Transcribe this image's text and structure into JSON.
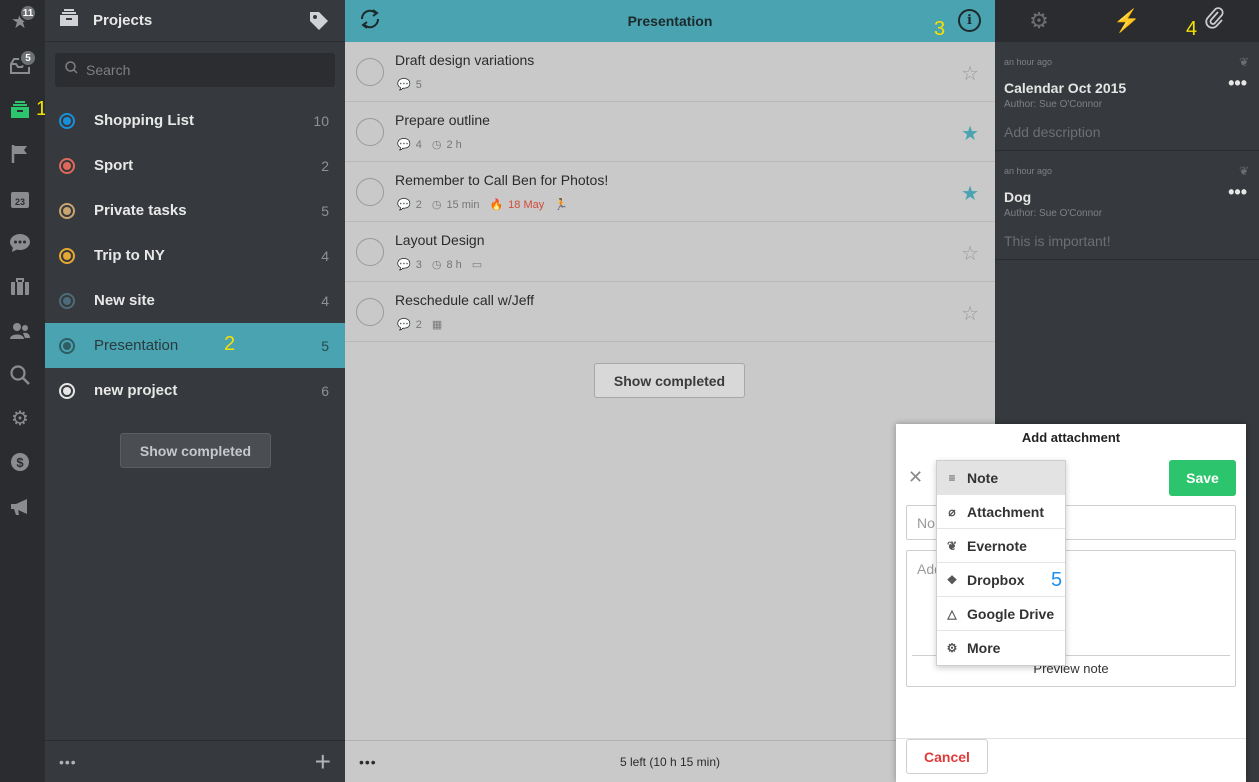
{
  "rail": {
    "starred_badge": "11",
    "inbox_badge": "5",
    "calendar_day": "23"
  },
  "callouts": {
    "c1": "1",
    "c2": "2",
    "c3": "3",
    "c4": "4",
    "c5": "5"
  },
  "sidebar": {
    "title": "Projects",
    "search_placeholder": "Search",
    "projects": [
      {
        "name": "Shopping List",
        "count": "10",
        "color": "#1a8fd9"
      },
      {
        "name": "Sport",
        "count": "2",
        "color": "#e0685b"
      },
      {
        "name": "Private tasks",
        "count": "5",
        "color": "#c9a46f"
      },
      {
        "name": "Trip to NY",
        "count": "4",
        "color": "#e5a833"
      },
      {
        "name": "New site",
        "count": "4",
        "color": "#4d6b78"
      },
      {
        "name": "Presentation",
        "count": "5",
        "color": "#2e5d62"
      },
      {
        "name": "new project",
        "count": "6",
        "color": "#e6e6e6"
      }
    ],
    "show_completed": "Show completed",
    "footer_more": "•••",
    "footer_add": "+"
  },
  "tasks": {
    "title": "Presentation",
    "items": [
      {
        "title": "Draft design variations",
        "comments": "5",
        "starred": false
      },
      {
        "title": "Prepare outline",
        "comments": "4",
        "duration": "2 h",
        "starred": true
      },
      {
        "title": "Remember to Call Ben for Photos!",
        "comments": "2",
        "duration": "15 min",
        "due": "18 May",
        "starred": true
      },
      {
        "title": "Layout Design",
        "comments": "3",
        "duration": "8 h",
        "starred": false
      },
      {
        "title": "Reschedule call w/Jeff",
        "comments": "2",
        "starred": false
      }
    ],
    "show_completed": "Show completed",
    "footer_more": "•••",
    "footer_summary": "5 left (10 h 15 min)"
  },
  "detail": {
    "attachments": [
      {
        "time": "an hour ago",
        "title": "Calendar Oct 2015",
        "author": "Author: Sue O'Connor",
        "description": "Add description"
      },
      {
        "time": "an hour ago",
        "title": "Dog",
        "author": "Author: Sue O'Connor",
        "description": "This is important!"
      }
    ],
    "more": "•••"
  },
  "modal": {
    "title": "Add attachment",
    "save": "Save",
    "name_placeholder": "No",
    "desc_placeholder": "Add",
    "preview": "Preview note",
    "cancel": "Cancel",
    "types": [
      {
        "label": "Note",
        "icon": "note-icon"
      },
      {
        "label": "Attachment",
        "icon": "paperclip-icon"
      },
      {
        "label": "Evernote",
        "icon": "evernote-icon"
      },
      {
        "label": "Dropbox",
        "icon": "dropbox-icon"
      },
      {
        "label": "Google Drive",
        "icon": "google-drive-icon"
      },
      {
        "label": "More",
        "icon": "gear-icon"
      }
    ]
  },
  "colors": {
    "accent_teal": "#4aa3b0",
    "save_green": "#2cc46c",
    "cancel_red": "#e03a3a",
    "callout_yellow": "#f5e100",
    "callout_blue": "#1e8ef0"
  }
}
